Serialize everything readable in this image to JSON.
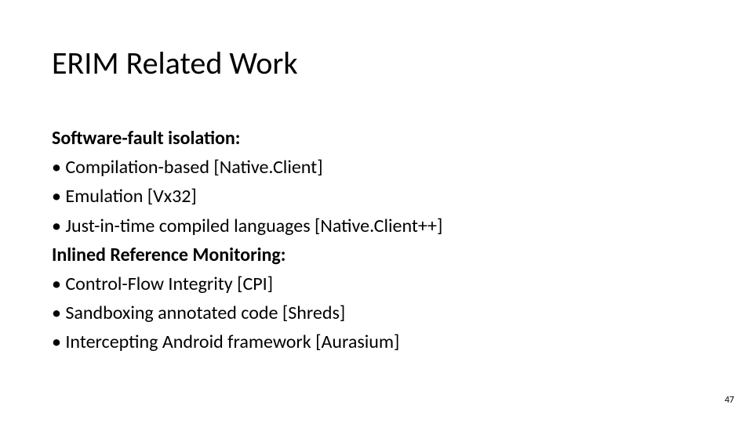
{
  "title": "ERIM Related Work",
  "section1_heading": "Software-fault isolation:",
  "section1_items": [
    "• Compilation-based [Native.Client]",
    "• Emulation [Vx32]",
    "• Just-in-time compiled languages [Native.Client++]"
  ],
  "section2_heading": "Inlined Reference Monitoring:",
  "section2_items": [
    "• Control-Flow Integrity [CPI]",
    "• Sandboxing annotated code [Shreds]",
    "• Intercepting Android framework [Aurasium]"
  ],
  "page_number": "47"
}
